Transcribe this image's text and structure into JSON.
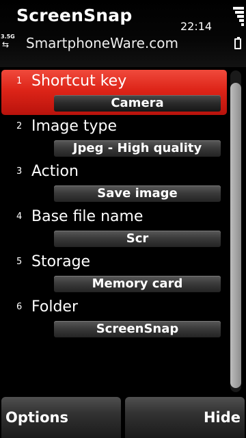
{
  "status": {
    "app_title": "ScreenSnap",
    "subtitle": "SmartphoneWare.com",
    "time": "22:14",
    "network": "3.5G",
    "icons": [
      "signal-strength-icon",
      "battery-icon",
      "data-transfer-icon"
    ]
  },
  "settings": [
    {
      "num": "1",
      "label": "Shortcut key",
      "value": "Camera"
    },
    {
      "num": "2",
      "label": "Image type",
      "value": "Jpeg - High quality"
    },
    {
      "num": "3",
      "label": "Action",
      "value": "Save image"
    },
    {
      "num": "4",
      "label": "Base file name",
      "value": "Scr"
    },
    {
      "num": "5",
      "label": "Storage",
      "value": "Memory card"
    },
    {
      "num": "6",
      "label": "Folder",
      "value": "ScreenSnap"
    }
  ],
  "selected_index": 0,
  "softkeys": {
    "left": "Options",
    "right": "Hide"
  },
  "colors": {
    "highlight": "#dd2418",
    "background": "#000000"
  }
}
